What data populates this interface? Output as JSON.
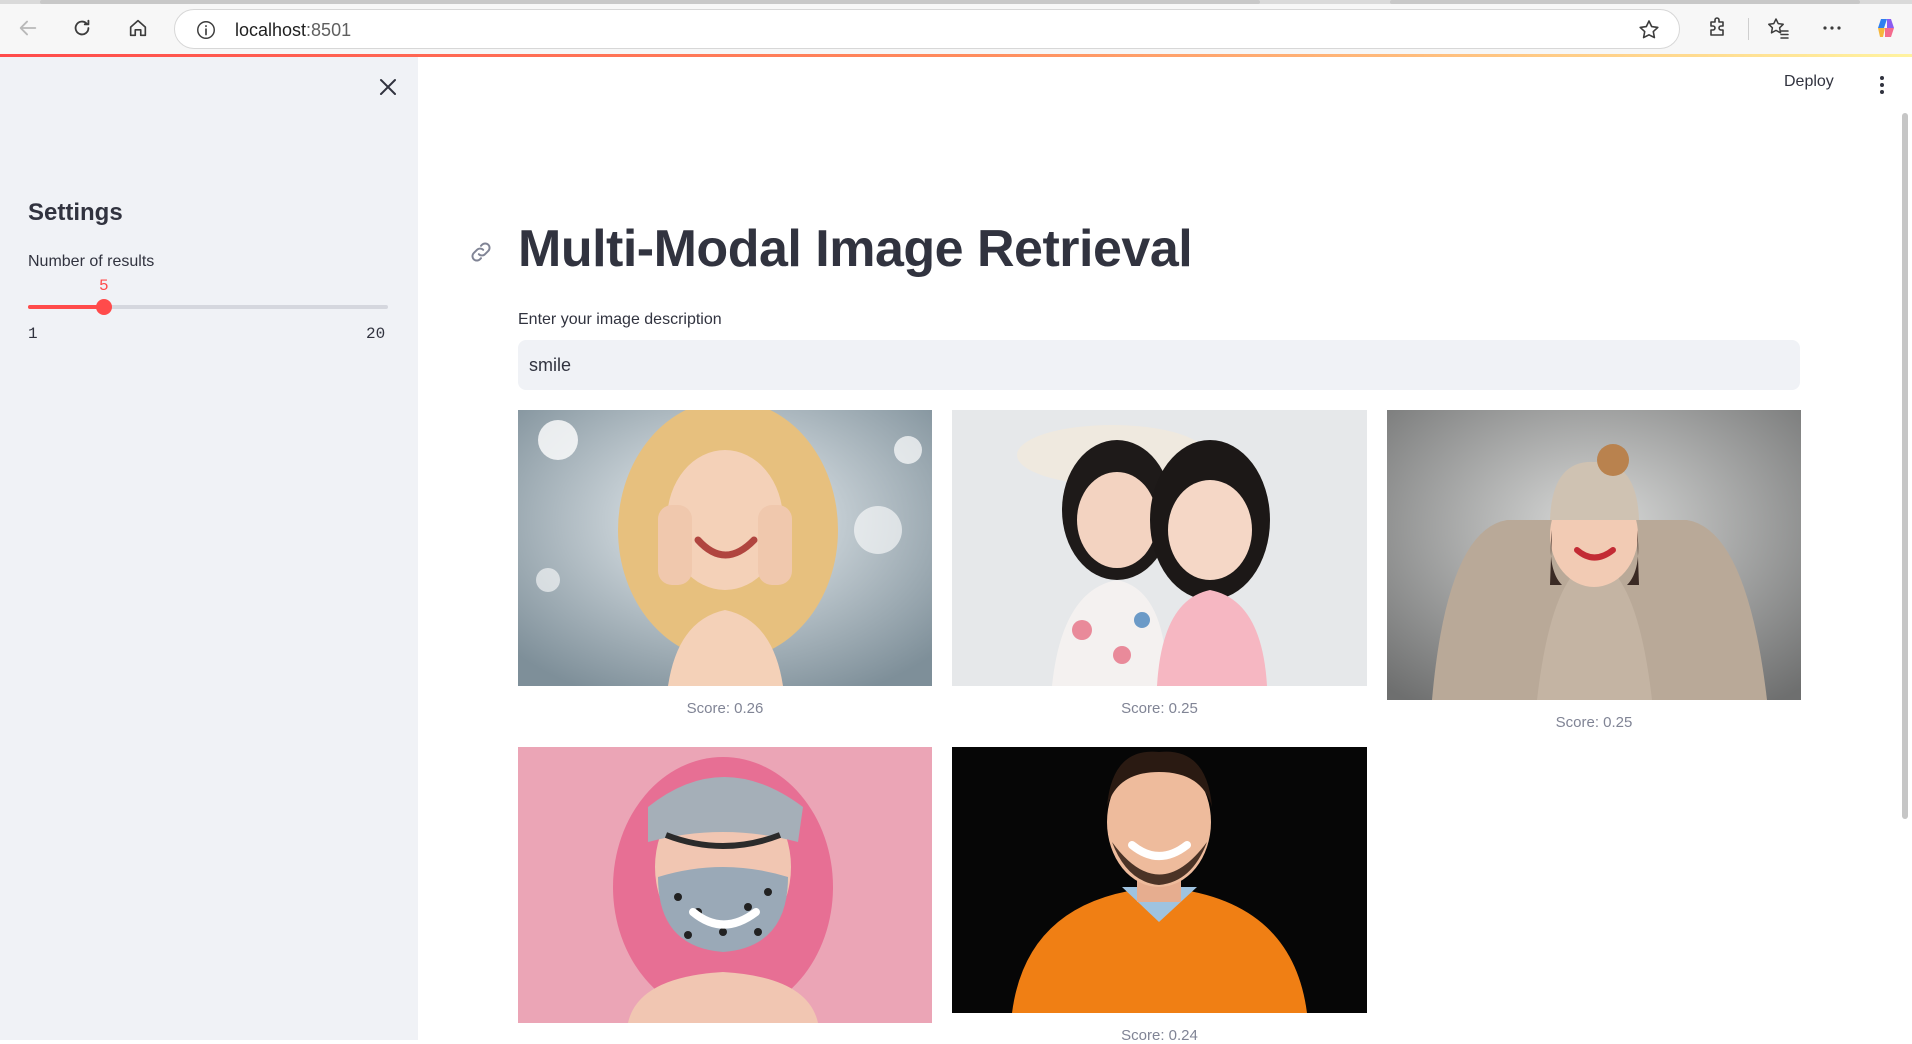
{
  "browser": {
    "url_host": "localhost",
    "url_port": ":8501"
  },
  "sidebar": {
    "title": "Settings",
    "slider": {
      "label": "Number of results",
      "value": 5,
      "value_text": "5",
      "min": 1,
      "max": 20,
      "min_text": "1",
      "max_text": "20"
    }
  },
  "header": {
    "deploy_label": "Deploy"
  },
  "main": {
    "title": "Multi-Modal Image Retrieval",
    "input_label": "Enter your image description",
    "input_value": "smile",
    "results": [
      {
        "caption": "Score: 0.26",
        "icon": "smiling-blonde-woman-photo"
      },
      {
        "caption": "Score: 0.25",
        "icon": "two-smiling-girls-photo"
      },
      {
        "caption": "Score: 0.25",
        "icon": "woman-in-beanie-photo"
      },
      {
        "caption": "",
        "icon": "pink-hair-woman-mask-photo"
      },
      {
        "caption": "Score: 0.24",
        "icon": "smiling-man-orange-sweater-photo"
      }
    ]
  },
  "colors": {
    "accent": "#ff4b4b",
    "sidebar_bg": "#f0f2f6",
    "text": "#31333f",
    "caption": "#808495"
  }
}
